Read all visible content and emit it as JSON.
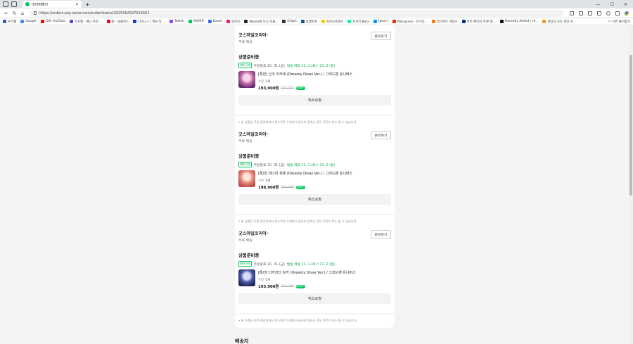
{
  "browser": {
    "tab_title": "네이버페이",
    "url": "https://orders.pay.naver.com/order/status/2025062597516561",
    "bookmarks": [
      {
        "label": "루리웹",
        "color": "#2b5fb4"
      },
      {
        "label": "Google",
        "color": "#4285f4"
      },
      {
        "label": "(24) YouTube",
        "color": "#ff0000"
      },
      {
        "label": "라프텔 - 애니 추천 ...",
        "color": "#6f3bd8"
      },
      {
        "label": "홈 - 넷플릭스",
        "color": "#e50914"
      },
      {
        "label": "디즈니+ | 영화 및 ...",
        "color": "#113ccf"
      },
      {
        "label": "Twitch",
        "color": "#9146ff"
      },
      {
        "label": "NAVER",
        "color": "#03c75a"
      },
      {
        "label": "Daum",
        "color": "#2f6ff5"
      },
      {
        "label": "알라딘",
        "color": "#e91e63"
      },
      {
        "label": "Steam에 오신 것을...",
        "color": "#1b2838"
      },
      {
        "label": "Origin",
        "color": "#333333"
      },
      {
        "label": "동행복권",
        "color": "#0b58a7"
      },
      {
        "label": "카카오프렌즈",
        "color": "#ffcd00"
      },
      {
        "label": "치지직 Beta",
        "color": "#00ffa3"
      },
      {
        "label": "[pixiv]",
        "color": "#0096fa"
      },
      {
        "label": "AliExpress - 인기있...",
        "color": "#e62e04"
      },
      {
        "label": "다이렉트 게임즈",
        "color": "#ff7a00"
      },
      {
        "label": "마이 페이지 TOP 통...",
        "color": "#003087"
      },
      {
        "label": "Recently Added | Hi...",
        "color": "#111111"
      },
      {
        "label": "게임의 모든 희망 포...",
        "color": "#f39c12"
      }
    ],
    "other_bookmarks": "다른 즐겨찾기"
  },
  "page": {
    "section_title": "배송지",
    "orders": [
      {
        "seller": "굿스마일코리아",
        "shipping": "무료 배송",
        "inquiry": "문의하기",
        "status": "상품준비중",
        "badge": "예약구매",
        "order_date": "주문종료 10. 31.(금)",
        "ship_estimate": "발송 예정 11. 1.(토)~11. 2.(일)",
        "product_name": "[특전] 신조 아카네 (Dreamy Divas Ver.) / 그리드맨 유니버스",
        "option_label": "수량",
        "quantity": "1개",
        "price": "193,900원",
        "original_price": "203,000",
        "pay_badge": "NPAY",
        "cancel": "취소요청",
        "note": "• 본 상품은 주문 종료일까지 취소주문 수정에 도달하지 못하는 경우 주문이 취소 될 수 있습니다."
      },
      {
        "seller": "굿스마일코리아",
        "shipping": "무료 배송",
        "inquiry": "문의하기",
        "status": "상품준비중",
        "badge": "예약구매",
        "order_date": "주문종료 10. 31.(금)",
        "ship_estimate": "발송 예정 11. 1.(토)~11. 2.(일)",
        "product_name": "[특전] 미나미 유메 (Dreamy Divas Ver.) / 그리드맨 유니버스",
        "option_label": "수량",
        "quantity": "1개",
        "price": "198,900원",
        "original_price": "203,000",
        "pay_badge": "NPAY",
        "cancel": "취소요청",
        "note": "• 본 상품은 주문 종료일까지 취소주문 수정에 도달하지 못하는 경우 주문이 취소 될 수 있습니다."
      },
      {
        "seller": "굿스마일코리아",
        "shipping": "무료 배송",
        "inquiry": "문의하기",
        "status": "상품준비중",
        "badge": "예약구매",
        "order_date": "주문종료 10. 31.(금)",
        "ship_estimate": "발송 예정 11. 1.(토)~11. 2.(일)",
        "product_name": "[특전] 다카라다 릿카 (Dreamy Divas Ver.) / 그리드맨 유니버스",
        "option_label": "수량",
        "quantity": "1개",
        "price": "193,900원",
        "original_price": "203,000",
        "pay_badge": "NPAY",
        "cancel": "취소요청",
        "note": "• 본 상품은 주문 종료일까지 취소주문 수정에 도달하지 못하는 경우 주문이 취소 될 수 있습니다."
      }
    ]
  }
}
